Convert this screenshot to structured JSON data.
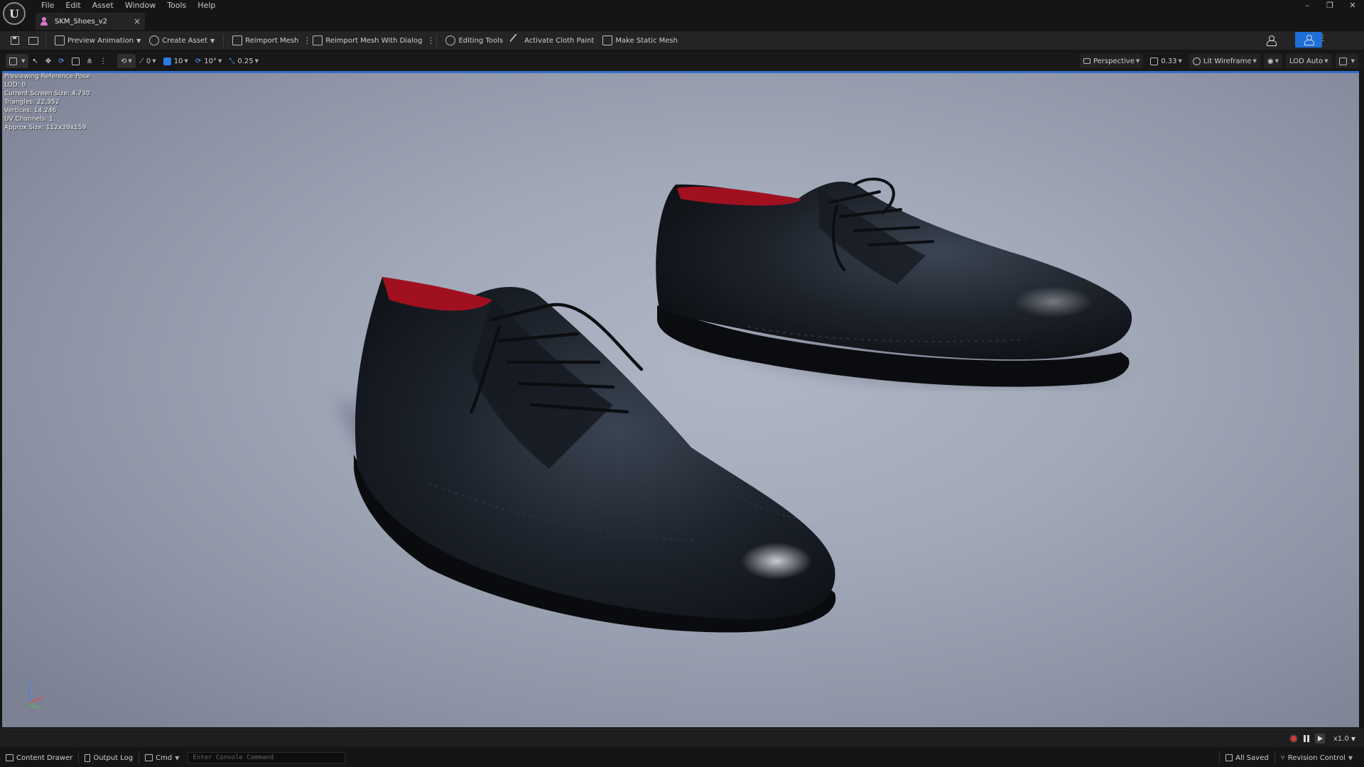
{
  "app": {
    "menu": [
      "File",
      "Edit",
      "Asset",
      "Window",
      "Tools",
      "Help"
    ],
    "tab": {
      "label": "SKM_Shoes_v2",
      "close": "×"
    },
    "window_controls": {
      "minimize": "–",
      "restore": "❐",
      "close": "✕"
    }
  },
  "toolbar": {
    "preview_animation": "Preview Animation",
    "create_asset": "Create Asset",
    "reimport_mesh": "Reimport Mesh",
    "reimport_mesh_dialog": "Reimport Mesh With Dialog",
    "editing_tools": "Editing Tools",
    "activate_cloth_paint": "Activate Cloth Paint",
    "make_static_mesh": "Make Static Mesh"
  },
  "viewport_toolbar": {
    "rotate_snap": "0",
    "grid_snap": "10",
    "angle_snap": "10°",
    "scale_snap": "0.25",
    "view_mode": "Perspective",
    "screen_percentage": "0.33",
    "lighting_mode": "Lit Wireframe",
    "lod": "LOD Auto"
  },
  "stats": [
    "Previewing Reference Pose",
    "LOD: 0",
    "Current Screen Size: 4.730",
    "Triangles: 22,352",
    "Vertices: 14,246",
    "UV Channels: 1",
    "Approx Size: 112x39x159"
  ],
  "gizmo": {
    "x": "X",
    "y": "Y",
    "z": "Z"
  },
  "playback": {
    "speed": "x1.0"
  },
  "statusbar": {
    "content_drawer": "Content Drawer",
    "output_log": "Output Log",
    "cmd": "Cmd",
    "console_placeholder": "Enter Console Command",
    "saved": "All Saved",
    "revision_control": "Revision Control"
  },
  "colors": {
    "accent": "#1e6fd8",
    "leather": "#1c2129",
    "lining": "#a0101f",
    "viewport_bg": "#a1a8b8"
  }
}
